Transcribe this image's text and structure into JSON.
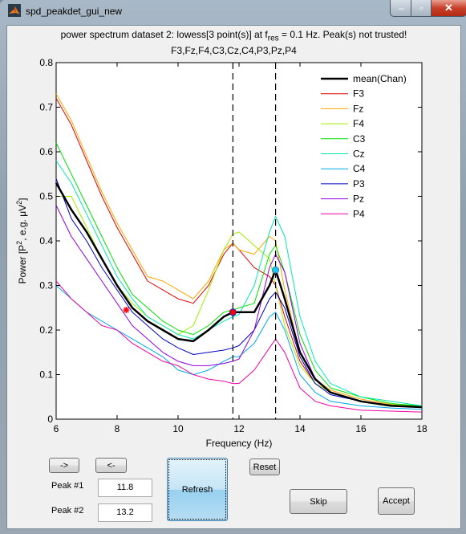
{
  "window": {
    "title": "spd_peakdet_gui_new",
    "controls": {
      "minimize": "–",
      "maximize": "▫",
      "close": "✕"
    }
  },
  "header": {
    "line1_pre": "power spectrum dataset 2: lowess[3 point(s)] at f",
    "line1_sub": "res",
    "line1_post": " = 0.1 Hz. Peak(s) not trusted!",
    "line2": "F3,Fz,F4,C3,Cz,C4,P3,Pz,P4"
  },
  "chart_data": {
    "type": "line",
    "title": "power spectrum dataset 2: lowess[3 point(s)] at f_res = 0.1 Hz. Peak(s) not trusted! / F3,Fz,F4,C3,Cz,C4,P3,Pz,P4",
    "xlabel": "Frequency (Hz)",
    "ylabel_pre": "Power [P",
    "ylabel_sup1": "2",
    "ylabel_mid": ", e.g. μV",
    "ylabel_sup2": "2",
    "ylabel_post": "]",
    "xlim": [
      6,
      18
    ],
    "ylim": [
      0,
      0.8
    ],
    "xticks": [
      6,
      8,
      10,
      12,
      14,
      16,
      18
    ],
    "yticks": [
      0,
      0.1,
      0.2,
      0.3,
      0.4,
      0.5,
      0.6,
      0.7,
      0.8
    ],
    "grid": false,
    "legend_position": "top-right",
    "x": [
      6,
      6.5,
      7,
      7.5,
      8,
      8.5,
      9,
      9.5,
      10,
      10.5,
      11,
      11.5,
      11.8,
      12,
      12.5,
      13,
      13.2,
      13.5,
      14,
      14.5,
      15,
      16,
      17,
      18
    ],
    "series": [
      {
        "name": "mean(Chan)",
        "color": "#000000",
        "bold": true,
        "values": [
          0.53,
          0.47,
          0.42,
          0.36,
          0.3,
          0.25,
          0.22,
          0.2,
          0.18,
          0.175,
          0.2,
          0.23,
          0.24,
          0.24,
          0.24,
          0.3,
          0.335,
          0.27,
          0.15,
          0.09,
          0.06,
          0.04,
          0.03,
          0.027
        ]
      },
      {
        "name": "F3",
        "color": "#e00000",
        "values": [
          0.72,
          0.66,
          0.58,
          0.5,
          0.43,
          0.37,
          0.31,
          0.29,
          0.27,
          0.26,
          0.3,
          0.37,
          0.395,
          0.38,
          0.34,
          0.32,
          0.3,
          0.23,
          0.13,
          0.08,
          0.06,
          0.04,
          0.03,
          0.028
        ]
      },
      {
        "name": "Fz",
        "color": "#ffa500",
        "values": [
          0.73,
          0.67,
          0.59,
          0.51,
          0.44,
          0.38,
          0.32,
          0.31,
          0.29,
          0.27,
          0.31,
          0.38,
          0.395,
          0.38,
          0.37,
          0.41,
          0.4,
          0.29,
          0.15,
          0.09,
          0.065,
          0.045,
          0.033,
          0.03
        ]
      },
      {
        "name": "F4",
        "color": "#a0ee00",
        "values": [
          0.5,
          0.5,
          0.43,
          0.36,
          0.3,
          0.26,
          0.23,
          0.21,
          0.19,
          0.21,
          0.29,
          0.38,
          0.415,
          0.42,
          0.39,
          0.36,
          0.3,
          0.21,
          0.12,
          0.08,
          0.06,
          0.04,
          0.032,
          0.03
        ]
      },
      {
        "name": "C3",
        "color": "#00e000",
        "values": [
          0.62,
          0.55,
          0.48,
          0.41,
          0.34,
          0.28,
          0.25,
          0.22,
          0.2,
          0.19,
          0.21,
          0.24,
          0.245,
          0.25,
          0.26,
          0.37,
          0.39,
          0.33,
          0.19,
          0.11,
          0.07,
          0.05,
          0.035,
          0.03
        ]
      },
      {
        "name": "Cz",
        "color": "#00e8b0",
        "values": [
          0.58,
          0.53,
          0.46,
          0.39,
          0.32,
          0.27,
          0.23,
          0.21,
          0.19,
          0.18,
          0.2,
          0.22,
          0.23,
          0.235,
          0.3,
          0.42,
          0.455,
          0.41,
          0.23,
          0.13,
          0.08,
          0.05,
          0.04,
          0.03
        ]
      },
      {
        "name": "C4",
        "color": "#00a8e8",
        "values": [
          0.3,
          0.27,
          0.24,
          0.22,
          0.2,
          0.18,
          0.16,
          0.14,
          0.11,
          0.1,
          0.11,
          0.13,
          0.14,
          0.14,
          0.17,
          0.23,
          0.24,
          0.2,
          0.1,
          0.06,
          0.04,
          0.03,
          0.025,
          0.022
        ]
      },
      {
        "name": "P3",
        "color": "#0000c8",
        "values": [
          0.54,
          0.45,
          0.4,
          0.34,
          0.29,
          0.24,
          0.21,
          0.18,
          0.16,
          0.145,
          0.15,
          0.155,
          0.16,
          0.165,
          0.2,
          0.27,
          0.285,
          0.25,
          0.14,
          0.08,
          0.055,
          0.04,
          0.03,
          0.027
        ]
      },
      {
        "name": "Pz",
        "color": "#9000e0",
        "values": [
          0.48,
          0.41,
          0.36,
          0.31,
          0.26,
          0.21,
          0.18,
          0.15,
          0.13,
          0.12,
          0.12,
          0.125,
          0.13,
          0.135,
          0.2,
          0.34,
          0.37,
          0.33,
          0.17,
          0.09,
          0.06,
          0.04,
          0.03,
          0.027
        ]
      },
      {
        "name": "P4",
        "color": "#f000a0",
        "values": [
          0.31,
          0.27,
          0.24,
          0.21,
          0.2,
          0.17,
          0.15,
          0.13,
          0.12,
          0.1,
          0.09,
          0.085,
          0.08,
          0.08,
          0.11,
          0.16,
          0.18,
          0.15,
          0.07,
          0.04,
          0.03,
          0.02,
          0.018,
          0.016
        ]
      }
    ],
    "vlines": [
      11.8,
      13.2
    ],
    "markers": [
      {
        "type": "star",
        "x": 8.3,
        "y": 0.245,
        "color": "#ff0000"
      },
      {
        "type": "circle",
        "x": 11.8,
        "y": 0.24,
        "color": "#ff0000",
        "edge": "#2020c0"
      },
      {
        "type": "circle",
        "x": 13.2,
        "y": 0.335,
        "color": "#20c8f0",
        "edge": "#2080c0"
      }
    ]
  },
  "controls": {
    "next_label": "->",
    "prev_label": "<-",
    "reset_label": "Reset",
    "refresh_label": "Refresh",
    "skip_label": "Skip",
    "accept_label": "Accept",
    "peak1_label": "Peak #1",
    "peak1_value": "11.8",
    "peak2_label": "Peak #2",
    "peak2_value": "13.2"
  }
}
